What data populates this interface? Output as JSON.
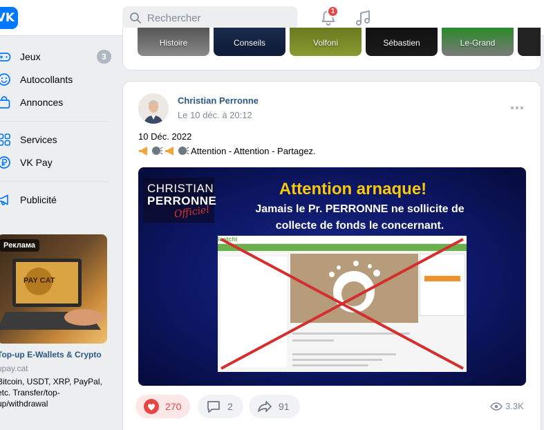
{
  "colors": {
    "accent": "#0077ff",
    "link": "#2a5885",
    "like": "#e64646",
    "secondary": "#818c99"
  },
  "header": {
    "logo_text": "VK",
    "search_placeholder": "Rechercher",
    "notifications_count": "1"
  },
  "sidebar": {
    "items": [
      {
        "label": "Jeux",
        "count": "3",
        "icon": "gamepad-icon"
      },
      {
        "label": "Autocollants",
        "icon": "smile-icon"
      },
      {
        "label": "Annonces",
        "icon": "shopping-bag-icon"
      },
      {
        "label": "Services",
        "icon": "grid-icon"
      },
      {
        "label": "VK Pay",
        "icon": "ruble-icon"
      },
      {
        "label": "Publicité",
        "icon": "megaphone-icon"
      }
    ],
    "ad": {
      "tag": "Реклама",
      "title": "Top-up E-Wallets & Crypto",
      "domain": "upay.cat",
      "description": "Bitcoin, USDT, XRP, PayPal, etc. Transfer/top-up/withdrawal",
      "image_label": "PAY CAT"
    }
  },
  "stories": [
    {
      "label": "Histoire"
    },
    {
      "label": "Conseils"
    },
    {
      "label": "Volfoni"
    },
    {
      "label": "Sébastien"
    },
    {
      "label": "Le-Grand"
    }
  ],
  "post": {
    "author": "Christian Perronne",
    "date": "Le 10 déc. à 20:12",
    "text_line1": "10 Déc. 2022",
    "text_line2": "Attention - Attention - Partagez.",
    "image": {
      "brand_line1": "CHRISTIAN",
      "brand_line2": "PERRONNE",
      "brand_line3": "Officiel",
      "headline": "Attention arnaque!",
      "subline1": "Jamais le Pr. PERRONNE ne sollicite de",
      "subline2": "collecte de fonds le concernant.",
      "screenshot_logo": "leetchi"
    },
    "likes": "270",
    "comments": "2",
    "shares": "91",
    "views": "3.3K"
  }
}
